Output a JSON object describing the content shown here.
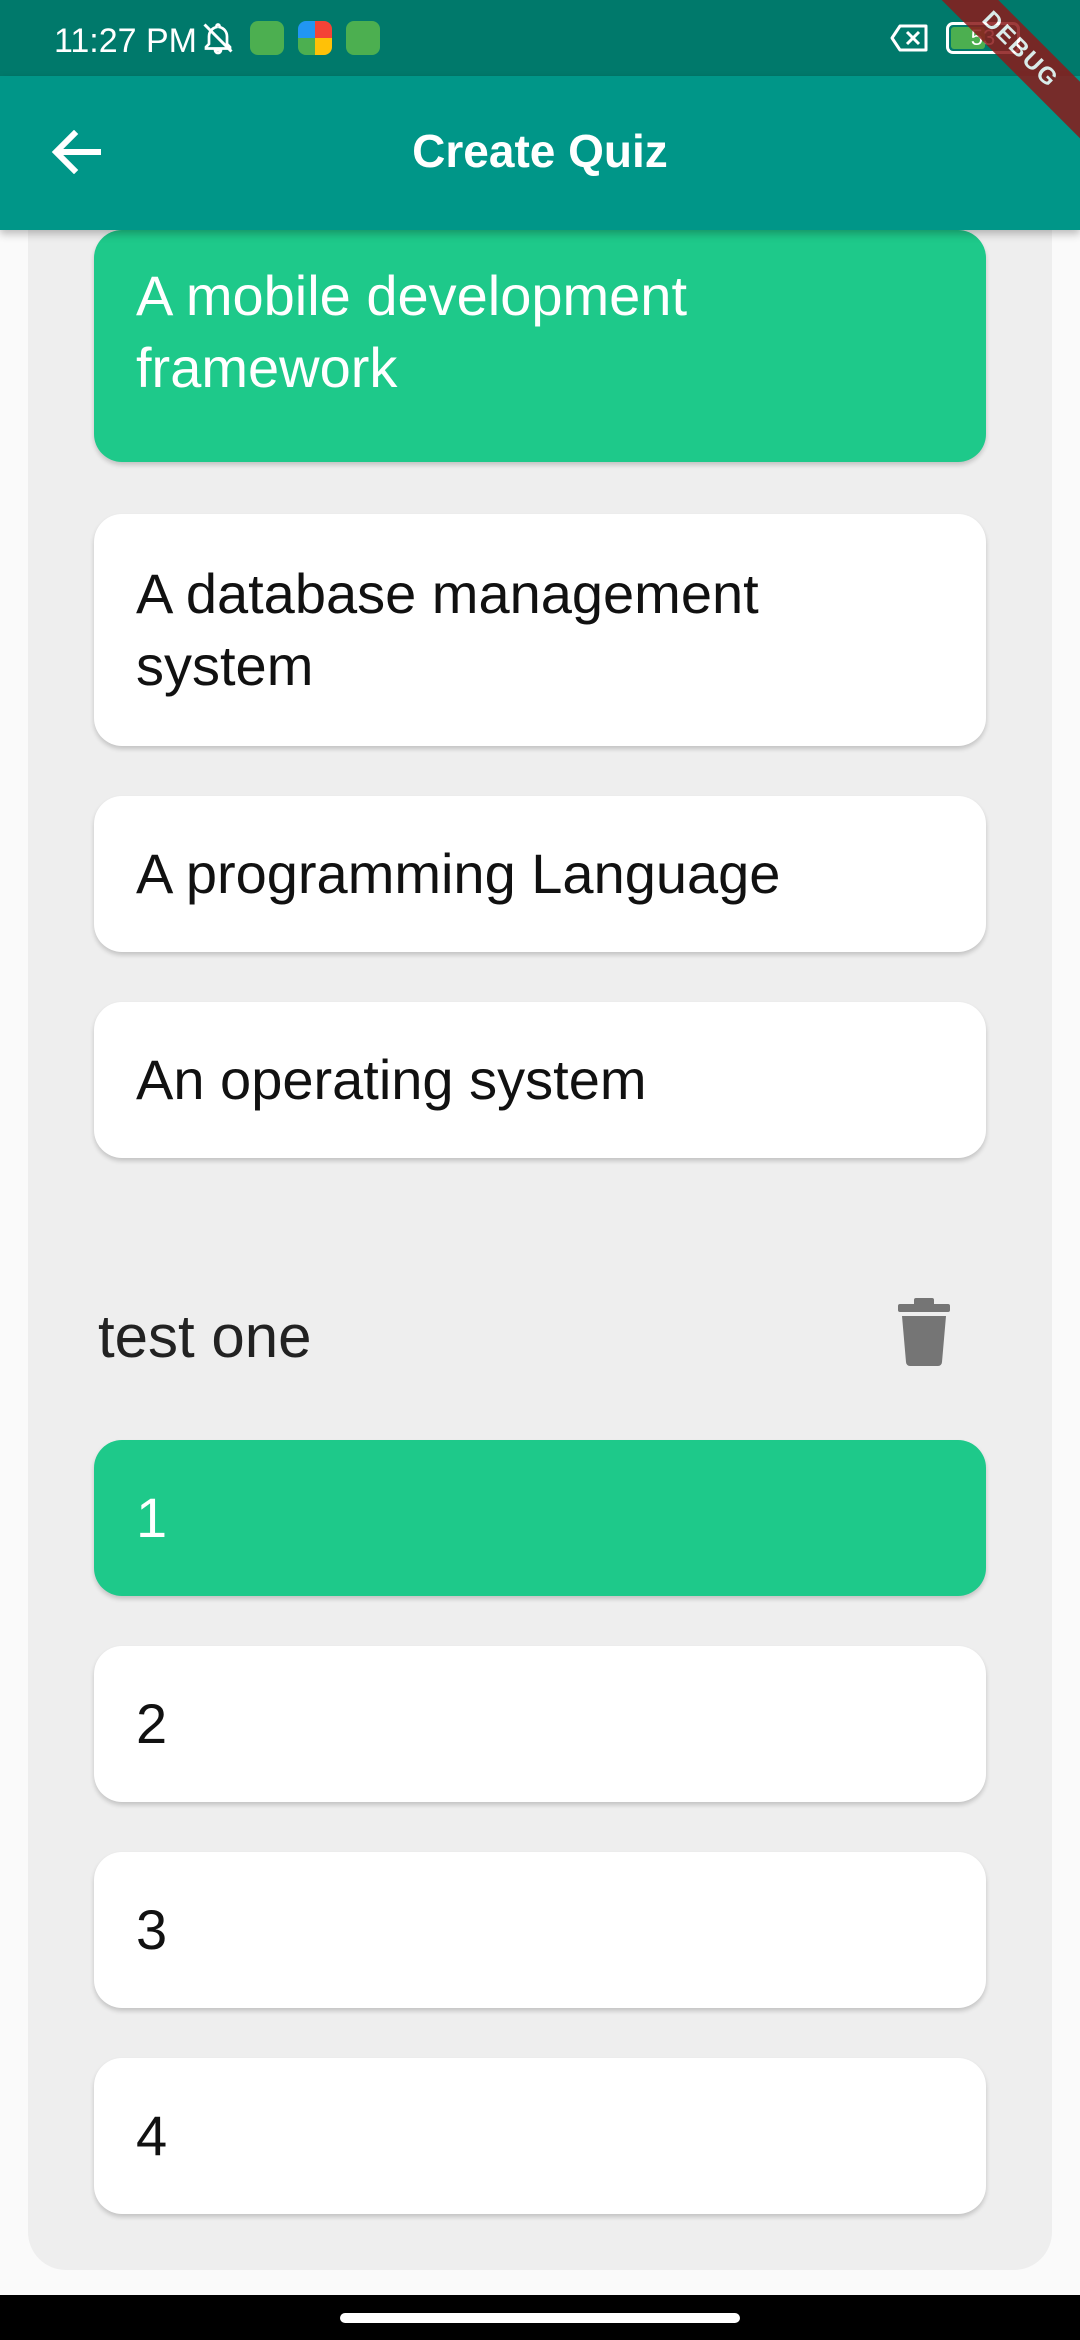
{
  "status_bar": {
    "time": "11:27 PM",
    "battery_level": "53",
    "debug_label": "DEBUG"
  },
  "app_bar": {
    "title": "Create Quiz",
    "back_icon": "arrow-back-icon"
  },
  "questions": [
    {
      "options": [
        {
          "label": "A mobile development framework",
          "correct": true
        },
        {
          "label": "A database management system",
          "correct": false
        },
        {
          "label": "A programming Language",
          "correct": false
        },
        {
          "label": "An operating system",
          "correct": false
        }
      ]
    },
    {
      "title": "test one",
      "delete_icon": "trash-icon",
      "options": [
        {
          "label": "1",
          "correct": true
        },
        {
          "label": "2",
          "correct": false
        },
        {
          "label": "3",
          "correct": false
        },
        {
          "label": "4",
          "correct": false
        }
      ]
    }
  ],
  "colors": {
    "status_bar": "#00796b",
    "app_bar": "#009688",
    "correct_option": "#1ec98a",
    "card_background": "#eeeeee"
  }
}
